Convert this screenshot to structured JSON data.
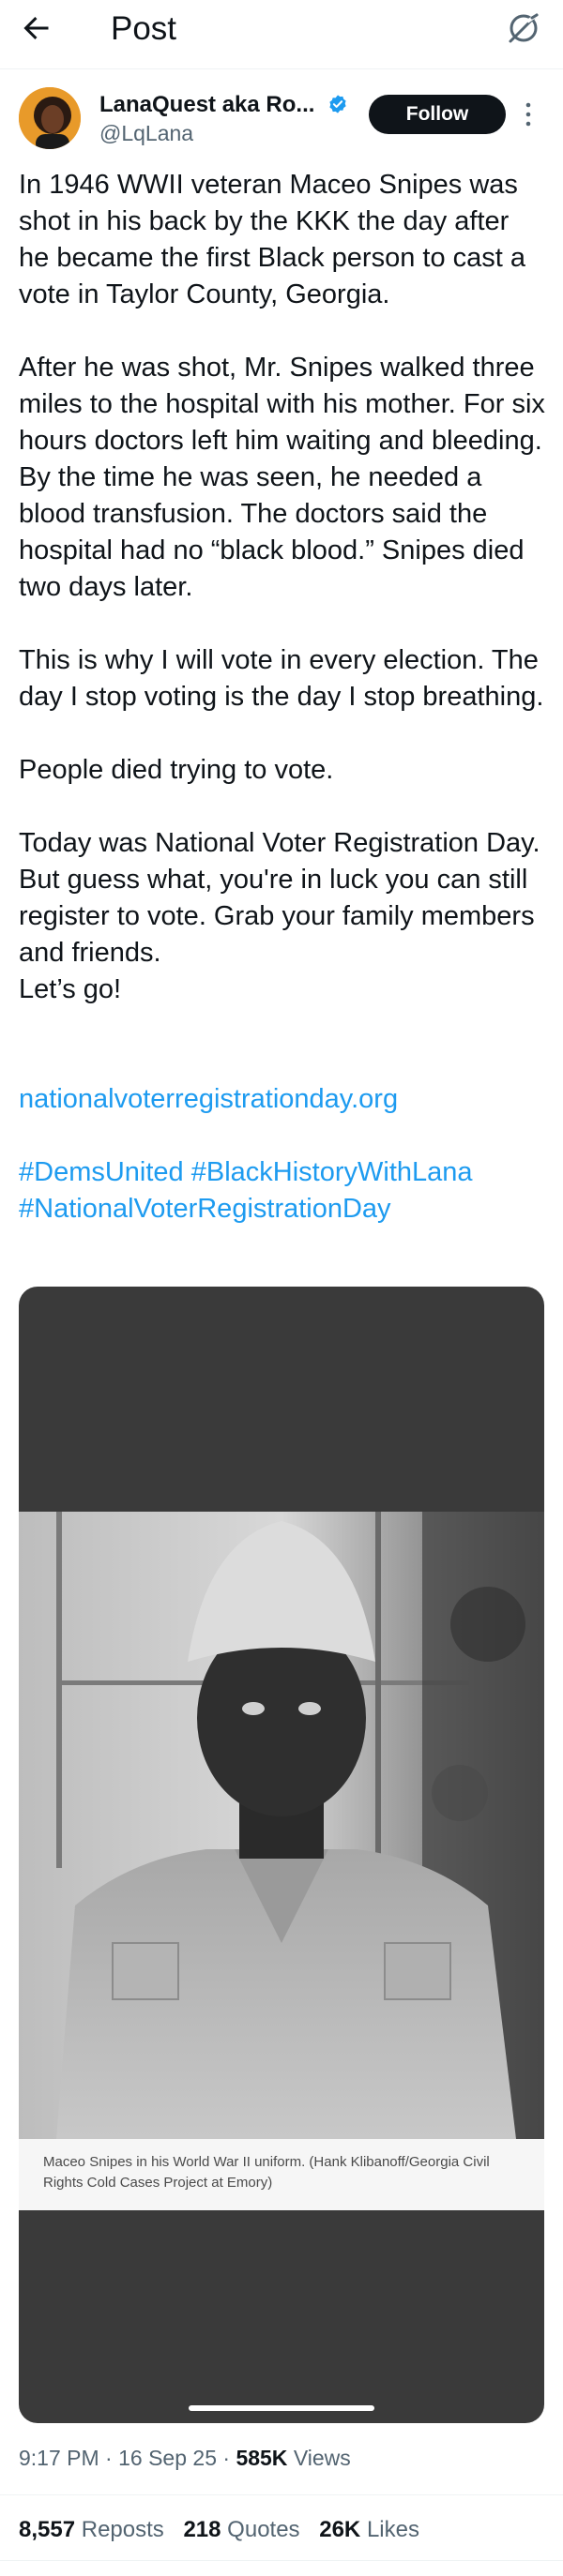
{
  "header": {
    "title": "Post",
    "back_icon": "arrow-left-icon",
    "grok_icon": "grok-icon"
  },
  "author": {
    "name": "LanaQuest aka Ro...",
    "handle": "@LqLana",
    "verified_color": "#1d9bf0",
    "follow_label": "Follow"
  },
  "post": {
    "paragraphs": [
      "In 1946 WWII veteran Maceo Snipes was shot in his back by the KKK the day after he became the first Black person to cast a vote in Taylor County, Georgia.",
      "After he was shot, Mr. Snipes walked three miles to the hospital with his mother. For six hours doctors left him waiting and bleeding. By the time he was seen, he needed a blood transfusion. The doctors said the hospital had no “black blood.” Snipes died two days later.",
      "This is why I will vote in every election. The day I stop voting is the day I stop breathing.",
      "People died trying to vote.",
      "Today was National Voter Registration Day. But guess what, you're in luck you can still register to vote. Grab your family members and friends.\nLet’s go!"
    ],
    "link": "nationalvoterregistrationday.org",
    "hashtags": [
      "#DemsUnited",
      "#BlackHistoryWithLana",
      "#NationalVoterRegistrationDay"
    ],
    "link_color": "#1d9bf0"
  },
  "media": {
    "caption": "Maceo Snipes in his World War II uniform. (Hank Klibanoff/Georgia Civil Rights Cold Cases Project at Emory)"
  },
  "meta": {
    "time": "9:17 PM",
    "date": "16 Sep 25",
    "views_count": "585K",
    "views_label": "Views"
  },
  "stats": {
    "reposts_count": "8,557",
    "reposts_label": "Reposts",
    "quotes_count": "218",
    "quotes_label": "Quotes",
    "likes_count": "26K",
    "likes_label": "Likes"
  }
}
